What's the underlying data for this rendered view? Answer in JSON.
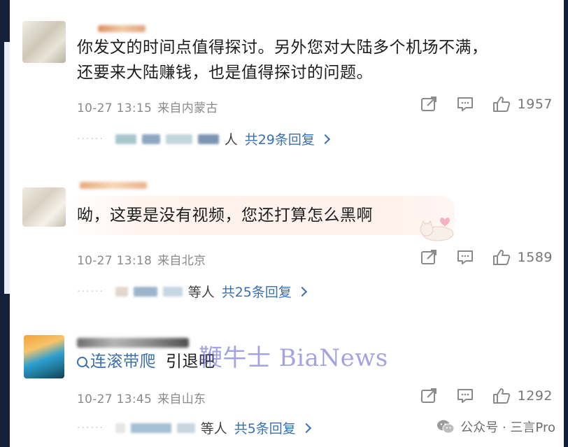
{
  "comments": [
    {
      "text_lines": [
        "你发文的时间点值得探讨。另外您对大陆多个机场不满，",
        "还要来大陆赚钱，也是值得探讨的问题。"
      ],
      "time": "10-27 13:15",
      "location": "来自内蒙古",
      "likes": "1957",
      "replies": {
        "who": "人",
        "total": "共29条回复"
      }
    },
    {
      "text": "呦，这要是没有视频，您还打算怎么黑啊",
      "time": "10-27 13:18",
      "location": "来自北京",
      "likes": "1589",
      "replies": {
        "who": "等人",
        "total": "共25条回复"
      }
    },
    {
      "search_text": "连滚带爬",
      "text": "引退吧",
      "time": "10-27 13:45",
      "location": "来自山东",
      "likes": "1292",
      "replies": {
        "who": "等人",
        "total": "共5条回复"
      }
    }
  ],
  "icons": {
    "share": "share-icon",
    "comment": "comment-icon",
    "like": "thumbs-up-icon",
    "search": "search-icon",
    "wechat": "wechat-icon",
    "reply_chevron": "chevron-right-icon"
  },
  "watermark": "鞭牛士 BiaNews",
  "footer": {
    "text": "公众号 · 三言Pro"
  },
  "colors": {
    "link": "#3a6fb0",
    "meta": "#8a8a8a",
    "watermark": "#5c57c9"
  }
}
